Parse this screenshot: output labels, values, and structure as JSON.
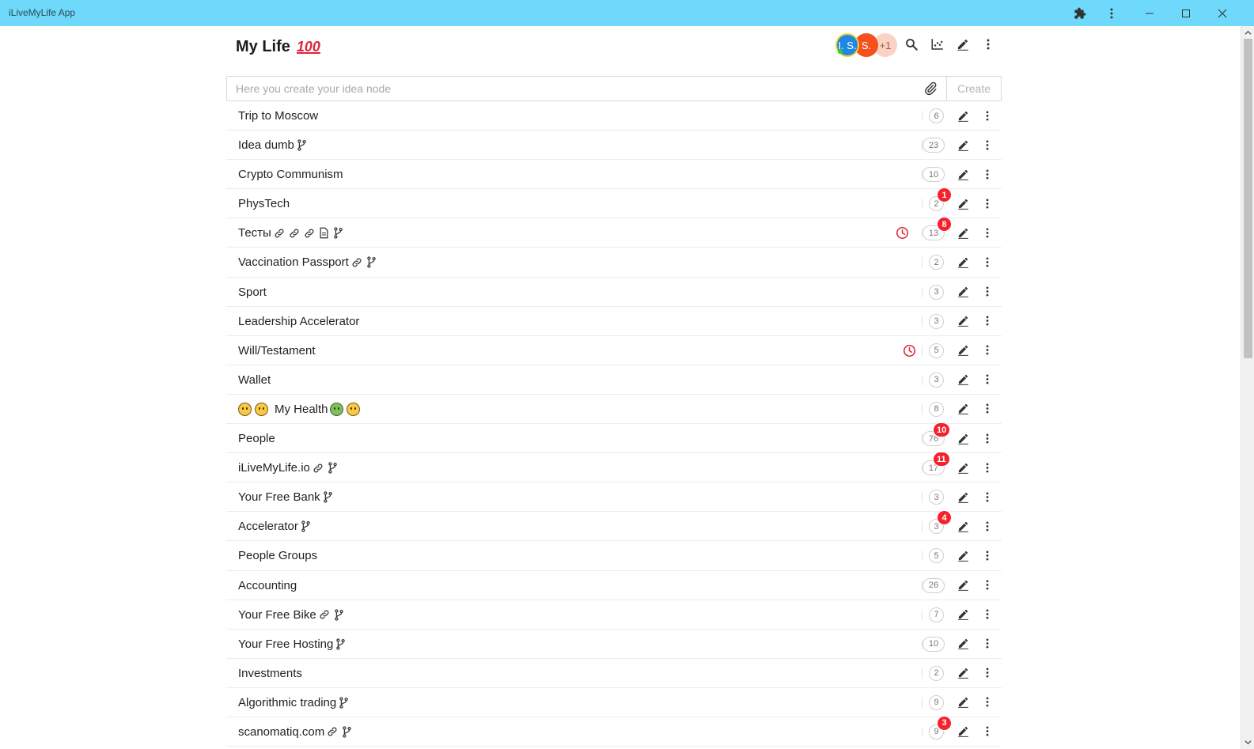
{
  "window": {
    "title": "iLiveMyLife App"
  },
  "header": {
    "title": "My Life",
    "title_emoji": "100",
    "avatars": [
      {
        "initials": "I. S.",
        "color": "#1e88e5",
        "online": true
      },
      {
        "initials": "S.",
        "color": "#f4511e"
      },
      {
        "initials": "+1",
        "color": "#fbd3c6"
      }
    ]
  },
  "create_bar": {
    "placeholder": "Here you create your idea node",
    "value": "",
    "create_label": "Create"
  },
  "nodes": [
    {
      "label": "Trip to Moscow",
      "count": "6",
      "icons": []
    },
    {
      "label": "Idea dumb",
      "count": "23",
      "icons": [
        "branch-icon"
      ]
    },
    {
      "label": "Crypto Communism",
      "count": "10",
      "icons": []
    },
    {
      "label": "PhysTech",
      "count": "2",
      "notification": "1",
      "icons": []
    },
    {
      "label": "Тесты",
      "count": "13",
      "notification": "8",
      "clock": true,
      "icons": [
        "link-icon",
        "link-icon",
        "link-icon",
        "document-icon",
        "branch-icon"
      ]
    },
    {
      "label": "Vaccination Passport",
      "count": "2",
      "icons": [
        "link-icon",
        "branch-icon"
      ]
    },
    {
      "label": "Sport",
      "count": "3",
      "icons": []
    },
    {
      "label": "Leadership Accelerator",
      "count": "3",
      "icons": []
    },
    {
      "label": "Will/Testament",
      "count": "5",
      "clock": true,
      "icons": []
    },
    {
      "label": "Wallet",
      "count": "3",
      "icons": []
    },
    {
      "label": "My Health",
      "count": "8",
      "prefix_emojis": [
        "worried-face-emoji",
        "tired-face-emoji"
      ],
      "suffix_emojis": [
        "nauseated-face-emoji",
        "silent-face-emoji"
      ],
      "icons": []
    },
    {
      "label": "People",
      "count": "76",
      "notification": "10",
      "icons": []
    },
    {
      "label": "iLiveMyLife.io",
      "count": "17",
      "notification": "11",
      "icons": [
        "link-icon",
        "branch-icon"
      ]
    },
    {
      "label": "Your Free Bank",
      "count": "3",
      "icons": [
        "branch-icon"
      ]
    },
    {
      "label": "Accelerator",
      "count": "3",
      "notification": "4",
      "icons": [
        "branch-icon"
      ]
    },
    {
      "label": "People Groups",
      "count": "5",
      "icons": []
    },
    {
      "label": "Accounting",
      "count": "26",
      "icons": []
    },
    {
      "label": "Your Free Bike",
      "count": "7",
      "icons": [
        "link-icon",
        "branch-icon"
      ]
    },
    {
      "label": "Your Free Hosting",
      "count": "10",
      "icons": [
        "branch-icon"
      ]
    },
    {
      "label": "Investments",
      "count": "2",
      "icons": []
    },
    {
      "label": "Algorithmic trading",
      "count": "9",
      "icons": [
        "branch-icon"
      ]
    },
    {
      "label": "scanomatiq.com",
      "count": "9",
      "notification": "3",
      "icons": [
        "link-icon",
        "branch-icon"
      ]
    }
  ],
  "colors": {
    "titlebar": "#6fd9fb",
    "notification": "#f5222d",
    "clock": "#e0243a"
  }
}
